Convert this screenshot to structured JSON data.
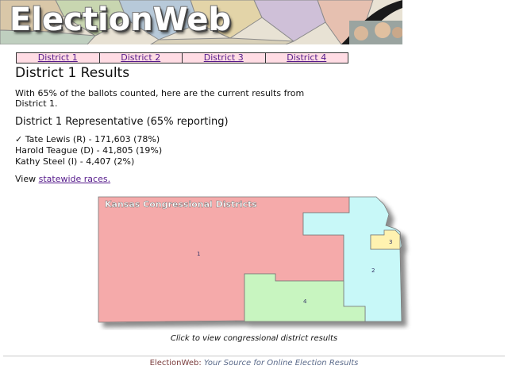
{
  "banner": {
    "title": "ElectionWeb",
    "map_colors": [
      "#d9c7a8",
      "#c8d6b0",
      "#b7c9d9",
      "#e3d4a8",
      "#cfc0d8",
      "#e6c0b0",
      "#bfcfbf",
      "#d8d0b8"
    ]
  },
  "tabs": [
    {
      "label": "District 1"
    },
    {
      "label": "District 2"
    },
    {
      "label": "District 3"
    },
    {
      "label": "District 4"
    }
  ],
  "main": {
    "title": "District 1 Results",
    "intro": "With 65% of the ballots counted, here are the current results from District 1.",
    "race_title": "District 1 Representative (65% reporting)",
    "candidates": [
      {
        "text": "✓ Tate Lewis (R) - 171,603 (78%)",
        "winner": true
      },
      {
        "text": "Harold Teague (D) - 41,805 (19%)",
        "winner": false
      },
      {
        "text": "Kathy Steel (I) - 4,407 (2%)",
        "winner": false
      }
    ],
    "view_prefix": "View ",
    "view_link": "statewide races."
  },
  "map": {
    "title": "Kansas Congressional Districts",
    "district_labels": [
      "1",
      "2",
      "3",
      "4"
    ],
    "colors": {
      "district1": "#f5aaaa",
      "district2": "#c8f8f8",
      "district3": "#fff2b0",
      "district4": "#c8f5c0"
    },
    "caption": "Click to view congressional district results"
  },
  "footer": {
    "brand": "ElectionWeb:",
    "tagline": "Your Source for Online Election Results"
  }
}
